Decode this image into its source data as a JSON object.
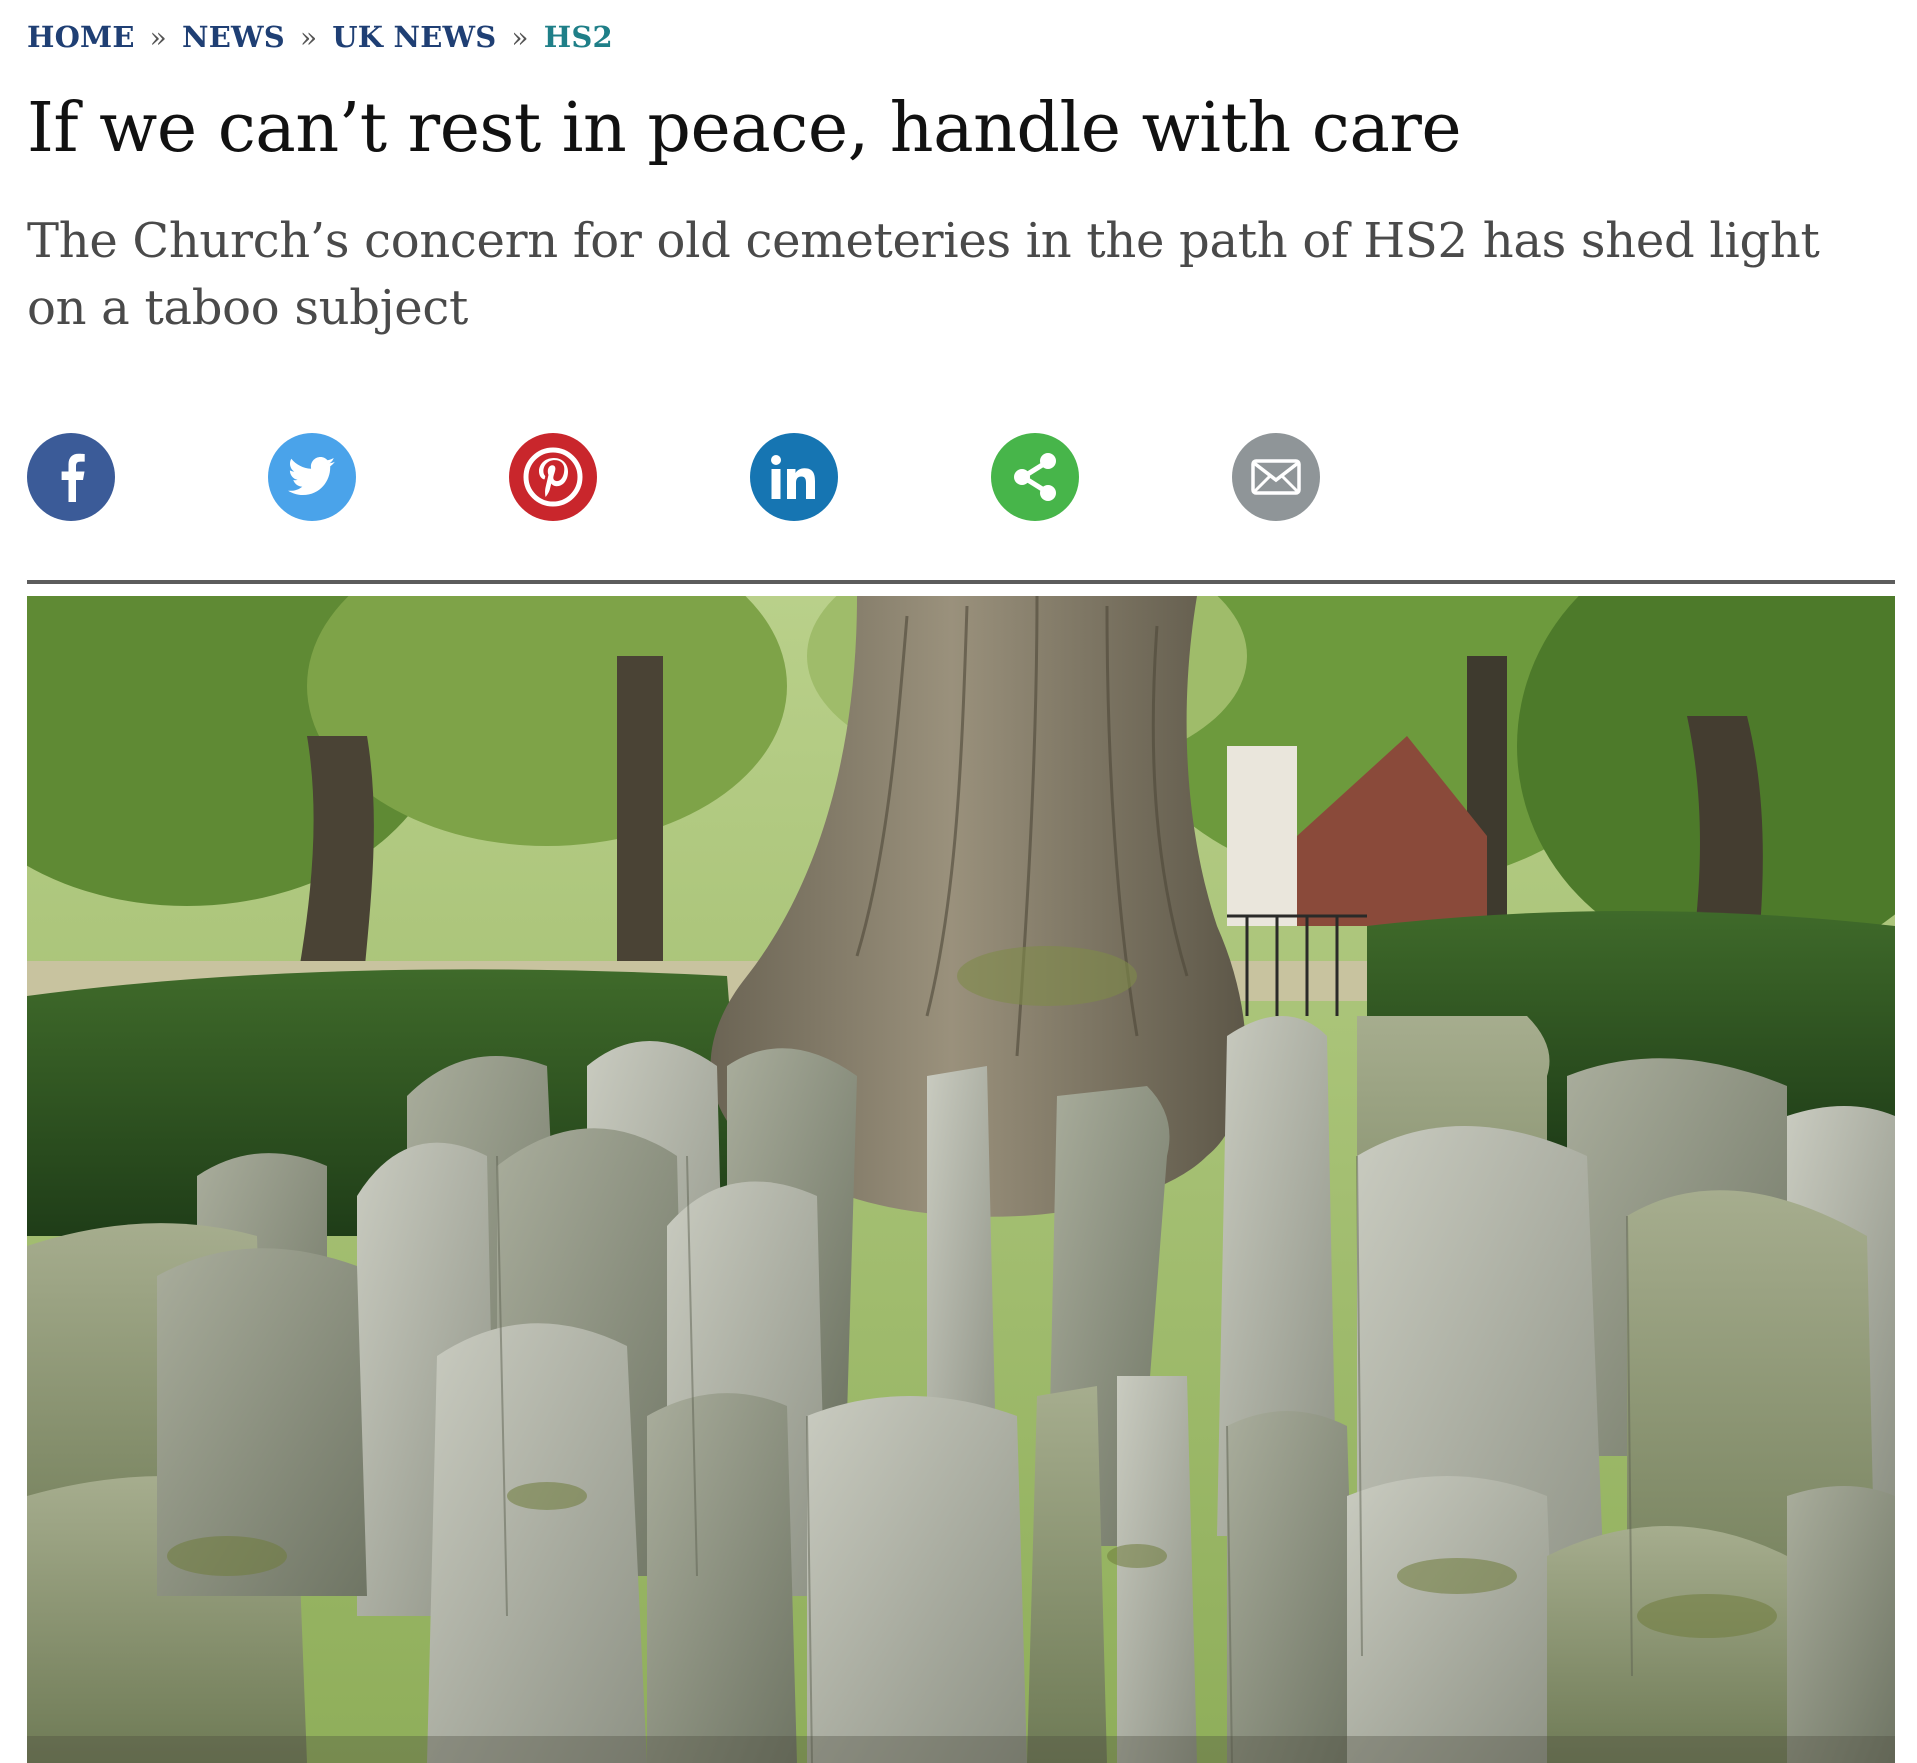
{
  "breadcrumb": {
    "items": [
      "HOME",
      "NEWS",
      "UK NEWS",
      "HS2"
    ],
    "separator": "»"
  },
  "article": {
    "headline": "If we can’t rest in peace, handle with care",
    "standfirst": "The Church’s concern for old cemeteries in the path of HS2 has shed light on a taboo subject"
  },
  "share": {
    "buttons": [
      {
        "icon": "facebook-icon",
        "color": "#3b5b98"
      },
      {
        "icon": "twitter-icon",
        "color": "#4aa3ea"
      },
      {
        "icon": "pinterest-icon",
        "color": "#c9262c"
      },
      {
        "icon": "linkedin-icon",
        "color": "#1675b2"
      },
      {
        "icon": "share-icon",
        "color": "#47b54a"
      },
      {
        "icon": "email-icon",
        "color": "#8f9598"
      }
    ]
  },
  "colors": {
    "breadcrumb_link": "#1f3f74",
    "breadcrumb_current": "#1f7f88",
    "headline": "#111111",
    "standfirst": "#4a4a4a"
  }
}
